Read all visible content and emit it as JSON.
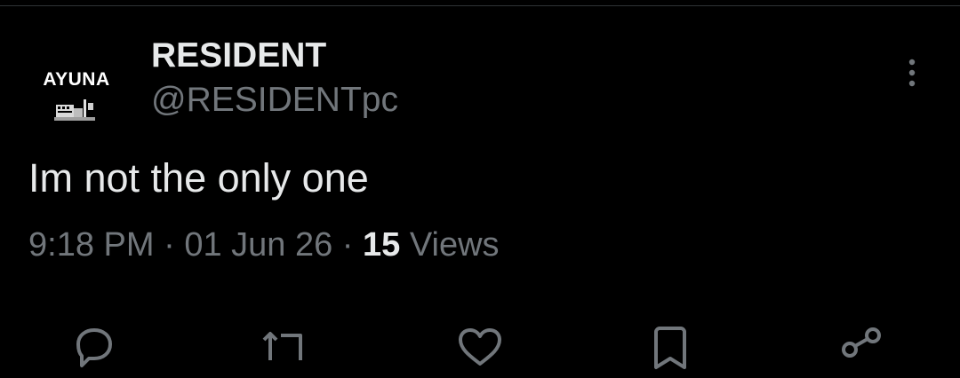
{
  "author": {
    "display_name": "RESIDENT",
    "handle": "@RESIDENTpc",
    "avatar_text": "AYUNA"
  },
  "tweet": {
    "text": "Im not the only one",
    "time": "9:18 PM",
    "date": "01 Jun 26",
    "views_count": "15",
    "views_label": "Views",
    "separator": "·"
  },
  "icons": {
    "more": "more-vertical-icon",
    "reply": "reply-icon",
    "retweet": "retweet-icon",
    "like": "like-icon",
    "bookmark": "bookmark-icon",
    "share": "share-icon"
  },
  "colors": {
    "background": "#000000",
    "primary_text": "#e7e9ea",
    "secondary_text": "#71767b",
    "divider": "#2f3336"
  }
}
